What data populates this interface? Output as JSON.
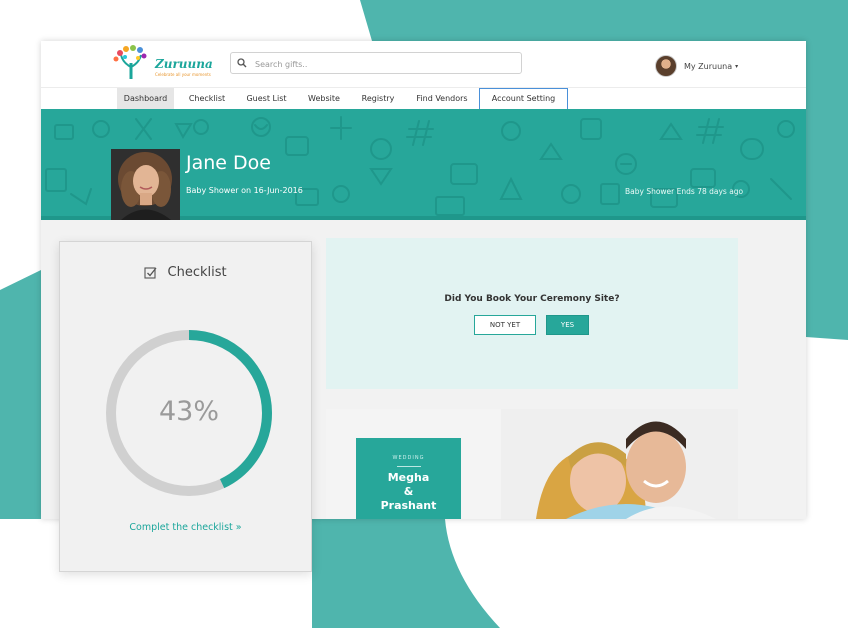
{
  "app": {
    "brand": "Zuruuna",
    "tagline": "Celebrate all your moments",
    "accent_color": "#27a79a"
  },
  "search": {
    "placeholder": "Search gifts.."
  },
  "user_menu": {
    "label": "My Zuruuna",
    "caret": "▾"
  },
  "nav": {
    "items": [
      {
        "label": "Dashboard",
        "active": true
      },
      {
        "label": "Checklist"
      },
      {
        "label": "Guest List"
      },
      {
        "label": "Website"
      },
      {
        "label": "Registry"
      },
      {
        "label": "Find Vendors"
      },
      {
        "label": "Account Setting",
        "focused": true
      }
    ]
  },
  "profile": {
    "name": "Jane Doe",
    "event": "Baby Shower on 16-Jun-2016",
    "ends": "Baby Shower Ends 78 days ago"
  },
  "checklist": {
    "title": "Checklist",
    "percent_text": "43%",
    "progress": 0.43,
    "link": "Complet the checklist »"
  },
  "prompt": {
    "question": "Did You Book Your Ceremony Site?",
    "no_label": "NOT YET",
    "yes_label": "YES"
  },
  "promo": {
    "kicker": "WEDDING",
    "names": "Megha\n&\nPrashant"
  },
  "icons": [
    "search-icon",
    "checklist-icon",
    "user-avatar"
  ]
}
